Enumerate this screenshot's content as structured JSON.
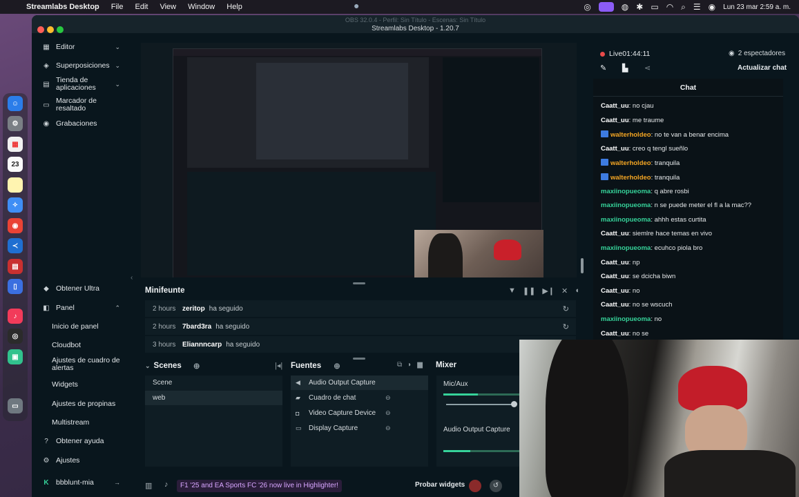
{
  "menubar": {
    "app_name": "Streamlabs Desktop",
    "items": [
      "File",
      "Edit",
      "View",
      "Window",
      "Help"
    ],
    "clock": "Lun 23 mar  2:59 a. m."
  },
  "window": {
    "background_title": "OBS 32.0.4 - Perfil: Sin Título - Escenas: Sin Título",
    "title": "Streamlabs Desktop - 1.20.7"
  },
  "sidebar": {
    "top_items": [
      {
        "label": "Editor",
        "icon": "layout-icon"
      },
      {
        "label": "Superposiciones",
        "icon": "overlay-icon"
      },
      {
        "label": "Tienda de aplicaciones",
        "icon": "store-icon"
      },
      {
        "label": "Marcador de resaltado",
        "icon": "highlighter-icon"
      },
      {
        "label": "Grabaciones",
        "icon": "recordings-icon"
      }
    ],
    "bottom_items": {
      "ultra": "Obtener Ultra",
      "panel": "Panel",
      "panel_children": [
        "Inicio de panel",
        "Cloudbot",
        "Ajustes de cuadro de alertas",
        "Widgets",
        "Ajustes de propinas",
        "Multistream"
      ],
      "help": "Obtener ayuda",
      "settings": "Ajustes",
      "account": "bbblunt-mia"
    }
  },
  "minifeed": {
    "title": "Minifeunte",
    "events": [
      {
        "time": "2 hours",
        "user": "zeritop",
        "action": "ha seguido"
      },
      {
        "time": "2 hours",
        "user": "7bard3ra",
        "action": "ha seguido"
      },
      {
        "time": "3 hours",
        "user": "Eliannncarp",
        "action": "ha seguido"
      }
    ]
  },
  "scenes": {
    "title": "Scenes",
    "items": [
      "Scene",
      "web"
    ],
    "selected": "web"
  },
  "sources": {
    "title": "Fuentes",
    "items": [
      {
        "label": "Audio Output Capture",
        "icon": "speaker-icon"
      },
      {
        "label": "Cuadro de chat",
        "icon": "chat-icon"
      },
      {
        "label": "Video Capture Device",
        "icon": "camera-icon"
      },
      {
        "label": "Display Capture",
        "icon": "monitor-icon"
      }
    ]
  },
  "mixer": {
    "title": "Mixer",
    "channels": [
      {
        "label": "Mic/Aux",
        "level": 0.45
      },
      {
        "label": "Audio Output Capture",
        "level": 0.35
      }
    ]
  },
  "bottombar": {
    "promo": "F1 '25 and EA Sports FC '26 now live in Highlighter!",
    "test_widgets": "Probar widgets"
  },
  "stream": {
    "live_label": "Live",
    "live_time": "01:44:11",
    "viewers": "2 espectadores",
    "refresh_chat": "Actualizar chat"
  },
  "chat": {
    "title": "Chat",
    "messages": [
      {
        "user": "Caatt_uu",
        "text": "no cjau",
        "color": "#ffffff",
        "badge": false
      },
      {
        "user": "Caatt_uu",
        "text": "me traume",
        "color": "#ffffff",
        "badge": false
      },
      {
        "user": "walterholdeo",
        "text": "no te van a benar encima",
        "color": "#f5a623",
        "badge": true
      },
      {
        "user": "Caatt_uu",
        "text": "creo q tengl sueñlo",
        "color": "#ffffff",
        "badge": false
      },
      {
        "user": "walterholdeo",
        "text": "tranquila",
        "color": "#f5a623",
        "badge": true
      },
      {
        "user": "walterholdeo",
        "text": "tranquila",
        "color": "#f5a623",
        "badge": true
      },
      {
        "user": "maxiinopueoma",
        "text": "q abre rosbi",
        "color": "#36d39a",
        "badge": false
      },
      {
        "user": "maxiinopueoma",
        "text": "n se puede meter el fl a la mac??",
        "color": "#36d39a",
        "badge": false
      },
      {
        "user": "maxiinopueoma",
        "text": "ahhh estas curtita",
        "color": "#36d39a",
        "badge": false
      },
      {
        "user": "Caatt_uu",
        "text": "siemlre hace temas en vivo",
        "color": "#ffffff",
        "badge": false
      },
      {
        "user": "maxiinopueoma",
        "text": "ecuhco piola bro",
        "color": "#36d39a",
        "badge": false
      },
      {
        "user": "Caatt_uu",
        "text": "np",
        "color": "#ffffff",
        "badge": false
      },
      {
        "user": "Caatt_uu",
        "text": "se dcicha biwn",
        "color": "#ffffff",
        "badge": false
      },
      {
        "user": "Caatt_uu",
        "text": "no",
        "color": "#ffffff",
        "badge": false
      },
      {
        "user": "Caatt_uu",
        "text": "no se wscuch",
        "color": "#ffffff",
        "badge": false
      },
      {
        "user": "maxiinopueoma",
        "text": "no",
        "color": "#36d39a",
        "badge": false
      },
      {
        "user": "Caatt_uu",
        "text": "no se",
        "color": "#ffffff",
        "badge": false
      }
    ]
  },
  "dock_badge": "23",
  "colors": {
    "accent": "#36d39a",
    "live": "#e84a4a",
    "promo": "#d8a6ff"
  }
}
